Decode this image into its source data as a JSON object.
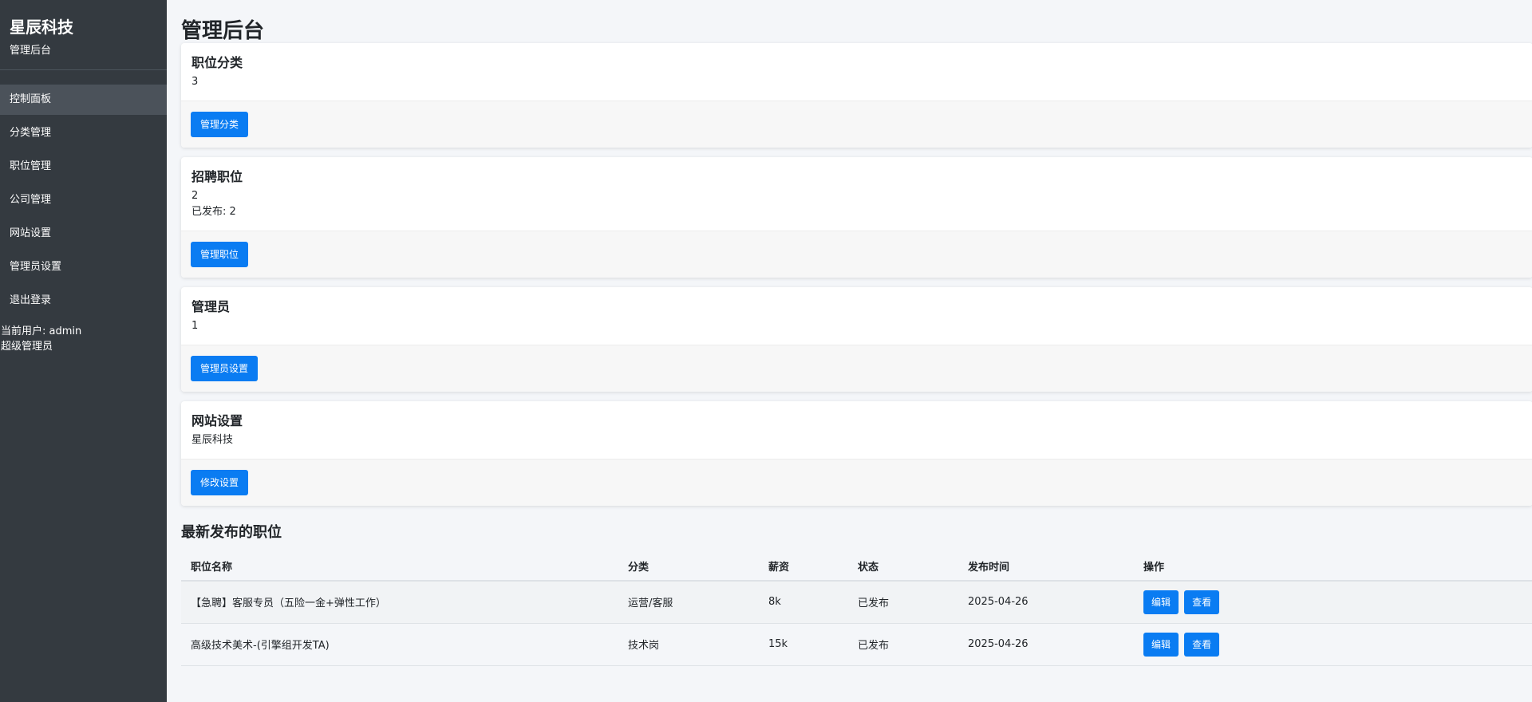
{
  "sidebar": {
    "brand_title": "星辰科技",
    "brand_sub": "管理后台",
    "items": [
      {
        "label": "控制面板"
      },
      {
        "label": "分类管理"
      },
      {
        "label": "职位管理"
      },
      {
        "label": "公司管理"
      },
      {
        "label": "网站设置"
      },
      {
        "label": "管理员设置"
      },
      {
        "label": "退出登录"
      }
    ],
    "current_user": "当前用户: admin",
    "role": "超级管理员"
  },
  "main": {
    "title": "管理后台",
    "cards": [
      {
        "title": "职位分类",
        "value": "3",
        "button": "管理分类"
      },
      {
        "title": "招聘职位",
        "value": "2",
        "extra": "已发布: 2",
        "button": "管理职位"
      },
      {
        "title": "管理员",
        "value": "1",
        "button": "管理员设置"
      },
      {
        "title": "网站设置",
        "value": "星辰科技",
        "button": "修改设置"
      }
    ],
    "latest_title": "最新发布的职位",
    "table": {
      "headers": [
        "职位名称",
        "分类",
        "薪资",
        "状态",
        "发布时间",
        "操作"
      ],
      "rows": [
        {
          "name": "【急聘】客服专员（五险一金+弹性工作）",
          "category": "运营/客服",
          "salary": "8k",
          "status": "已发布",
          "date": "2025-04-26",
          "edit": "编辑",
          "view": "查看"
        },
        {
          "name": "高级技术美术-(引擎组开发TA)",
          "category": "技术岗",
          "salary": "15k",
          "status": "已发布",
          "date": "2025-04-26",
          "edit": "编辑",
          "view": "查看"
        }
      ]
    }
  },
  "colors": {
    "sidebar_bg": "#343a40",
    "active_item_bg": "#4b525a",
    "primary": "#0a7cf2",
    "page_bg": "#f4f6f9"
  }
}
